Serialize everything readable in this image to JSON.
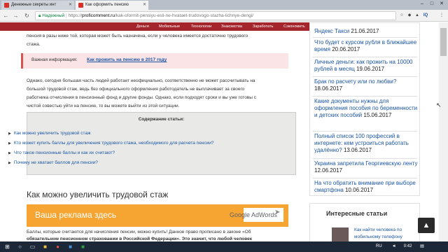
{
  "browser": {
    "tabs": [
      {
        "title": "Денежные секреты инт",
        "active": false
      },
      {
        "title": "Как оформить пенсию",
        "active": true
      }
    ],
    "url": {
      "secure_label": "Надежный",
      "scheme": "https://",
      "domain": "proficomment.ru",
      "path": "/kak-oformit-pensiyu-esli-ne-hvataet-trudovogo-stazha-lichnye-dengi/"
    },
    "ext_label": "IQ"
  },
  "site_nav": [
    "Деньги",
    "Мобильные",
    "Технологии",
    "Знакомства",
    "Заработать",
    "Сэкономить"
  ],
  "article": {
    "intro_line1": "пенсия в разы ниже той, которая может быть назначена, если у человека имеется достаточно трудового",
    "intro_line2": "стажа.",
    "callout_label": "Важная информация:",
    "callout_link": "Как прожить на пенсию в 2017 году",
    "para": [
      "Однако, сегодня большая часть людей работает неофициально, соответственно не может рассчитывать на",
      "большой трудовой стаж, ведь без официального оформления работодатель не выплачивает за своего",
      "работника отчисления в пенсионный фонд и другие фонды. Однако, если подходят сроки и вы уже готовы с",
      "чистой совестью уйти на пенсию, то вы можете выйти из этой ситуации."
    ],
    "toc_title": "Содержание статьи:",
    "toc_items": [
      "Как можно увеличить трудовой стаж",
      "Кто может купить баллы для увеличения трудового стажа, необходимого для расчета пенсии?",
      "Что такое пенсионные баллы и как их считают?",
      "Почему не хватает баллов для пенсии?"
    ],
    "heading": "Как можно увеличить трудовой стаж",
    "ad_text": "Ваша реклама здесь",
    "ad_brand": "Google AdWords",
    "bottom_line1": "Баллы, которые считаются для начисления пенсии, можно купить! Данное право прописано в  законе «Об",
    "bottom_line2": "обязательном пенсионном страховании в Российской Федерации». Это значит, что любой человек"
  },
  "sidebar": {
    "items": [
      {
        "title": "Яндекс Такси",
        "date": "21.06.2017"
      },
      {
        "title": "Что будет с курсом рубля в ближайшее время",
        "date": "20.06.2017"
      },
      {
        "title": "Личные деньги: как прожить на 10000 рублей в месяц",
        "date": "19.06.2017"
      },
      {
        "title": "Брак по расчету или по любви?",
        "date": "18.06.2017"
      },
      {
        "title": "Какие документы нужны для оформления пособия по беременности и детских пособий",
        "date": "15.06.2017"
      },
      {
        "title": "Полный список 100 профессий в интернете: кем устроиться работать удалённо?",
        "date": "13.06.2017"
      },
      {
        "title": "Украина запретила Георгиевскую ленту",
        "date": "12.06.2017"
      },
      {
        "title": "На что обратить внимание при выборе смартфона",
        "date": "10.06.2017"
      }
    ],
    "widget_title": "Интересные статьи",
    "widget_link": "Как найти человека по мобильному телефону"
  },
  "taskbar": {
    "lang": "RU",
    "time": "0:42"
  }
}
